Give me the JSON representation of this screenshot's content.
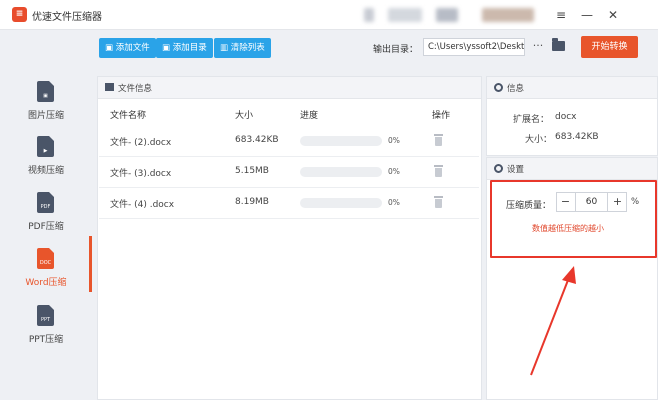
{
  "window": {
    "title": "优速文件压缩器",
    "logo": "logo-icon",
    "controls": [
      "menu-icon",
      "minimize-icon",
      "close-icon"
    ]
  },
  "sidebar": {
    "items": [
      {
        "label": "图片压缩",
        "icon": "image-file-icon",
        "active": false
      },
      {
        "label": "视频压缩",
        "icon": "video-file-icon",
        "active": false
      },
      {
        "label": "PDF压缩",
        "icon": "pdf-file-icon",
        "icon_text": "PDF",
        "active": false
      },
      {
        "label": "Word压缩",
        "icon": "word-file-icon",
        "icon_text": "DOC",
        "active": true
      },
      {
        "label": "PPT压缩",
        "icon": "ppt-file-icon",
        "icon_text": "PPT",
        "active": false
      }
    ]
  },
  "toolbar": {
    "add_file": "添加文件",
    "add_dir": "添加目录",
    "clear_list": "清除列表",
    "output_label": "输出目录：",
    "output_path": "C:\\Users\\yssoft2\\Deskt",
    "more": "···",
    "start": "开始转换"
  },
  "file_panel": {
    "title": "文件信息",
    "columns": [
      "文件名称",
      "大小",
      "进度",
      "操作"
    ],
    "rows": [
      {
        "name": "文件- (2).docx",
        "size": "683.42KB",
        "progress": "0%"
      },
      {
        "name": "文件- (3).docx",
        "size": "5.15MB",
        "progress": "0%"
      },
      {
        "name": "文件- (4) .docx",
        "size": "8.19MB",
        "progress": "0%"
      }
    ]
  },
  "info_panel": {
    "title": "信息",
    "ext_label": "扩展名：",
    "ext_value": "docx",
    "size_label": "大小：",
    "size_value": "683.42KB"
  },
  "settings_panel": {
    "title": "设置",
    "quality_label": "压缩质量：",
    "minus": "−",
    "quality_value": "60",
    "plus": "+",
    "unit": "%",
    "hint": "数值越低压缩的越小"
  },
  "colors": {
    "accent": "#e8552b",
    "toolbar_button": "#2aa3e8",
    "annotation": "#e8372b"
  }
}
